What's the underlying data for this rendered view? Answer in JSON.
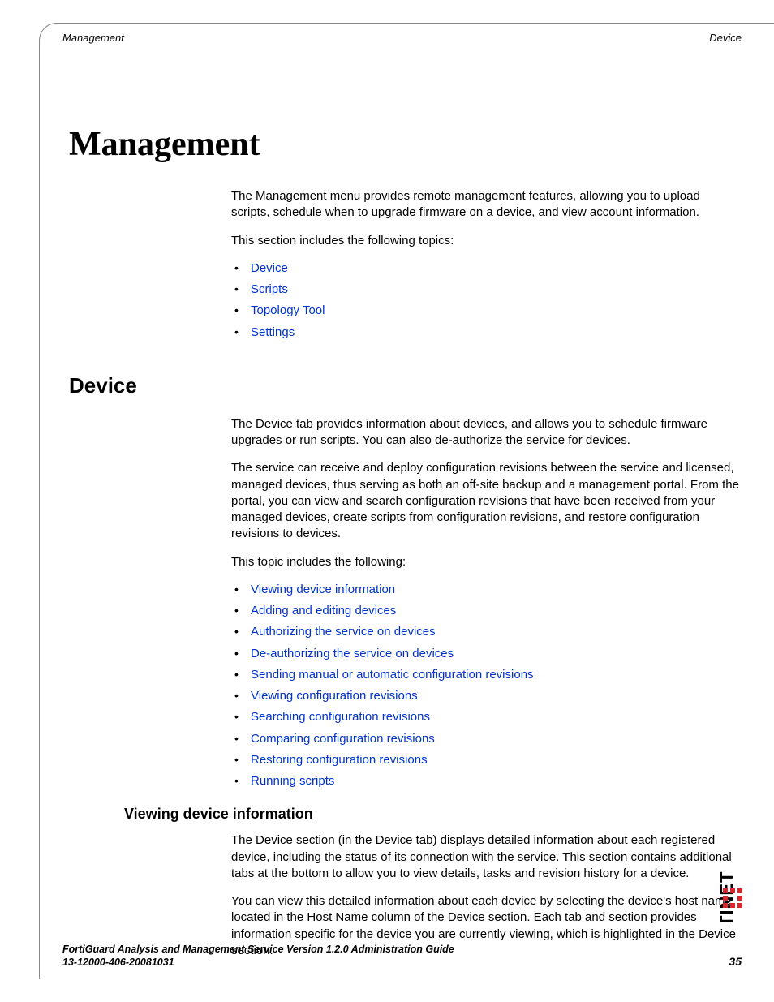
{
  "header": {
    "left": "Management",
    "right": "Device"
  },
  "title": "Management",
  "intro": {
    "p1": "The Management menu provides remote management features, allowing you to upload scripts, schedule when to upgrade firmware on a device, and view account information.",
    "p2": "This section includes the following topics:"
  },
  "topics": {
    "t0": "Device",
    "t1": "Scripts",
    "t2": "Topology Tool",
    "t3": "Settings"
  },
  "device": {
    "heading": "Device",
    "p1": "The Device tab provides information about devices, and allows you to schedule firmware upgrades or run scripts. You can also de-authorize the service for devices.",
    "p2": "The service can receive and deploy configuration revisions between the service and licensed, managed devices, thus serving as both an off-site backup and a management portal. From the portal, you can view and search configuration revisions that have been received from your managed devices, create scripts from configuration revisions, and restore configuration revisions to devices.",
    "p3": "This topic includes the following:",
    "links": {
      "l0": "Viewing device information",
      "l1": "Adding and editing devices",
      "l2": "Authorizing the service on devices",
      "l3": "De-authorizing the service on devices",
      "l4": "Sending manual or automatic configuration revisions",
      "l5": "Viewing configuration revisions",
      "l6": "Searching configuration revisions",
      "l7": "Comparing configuration revisions",
      "l8": "Restoring configuration revisions",
      "l9": "Running scripts"
    }
  },
  "viewing": {
    "heading": "Viewing device information",
    "p1": "The Device section (in the Device tab) displays detailed information about each registered device, including the status of its connection with the service. This section contains additional tabs at the bottom to allow you to view details, tasks and revision history for a device.",
    "p2": "You can view this detailed information about each device by selecting the device's host name, located in the Host Name column of the Device section. Each tab and section provides information specific for the device you are currently viewing, which is highlighted in the Device section."
  },
  "footer": {
    "line1": "FortiGuard Analysis and Management Service Version 1.2.0 Administration Guide",
    "line2": "13-12000-406-20081031",
    "page": "35"
  },
  "brand": "FORTINET"
}
